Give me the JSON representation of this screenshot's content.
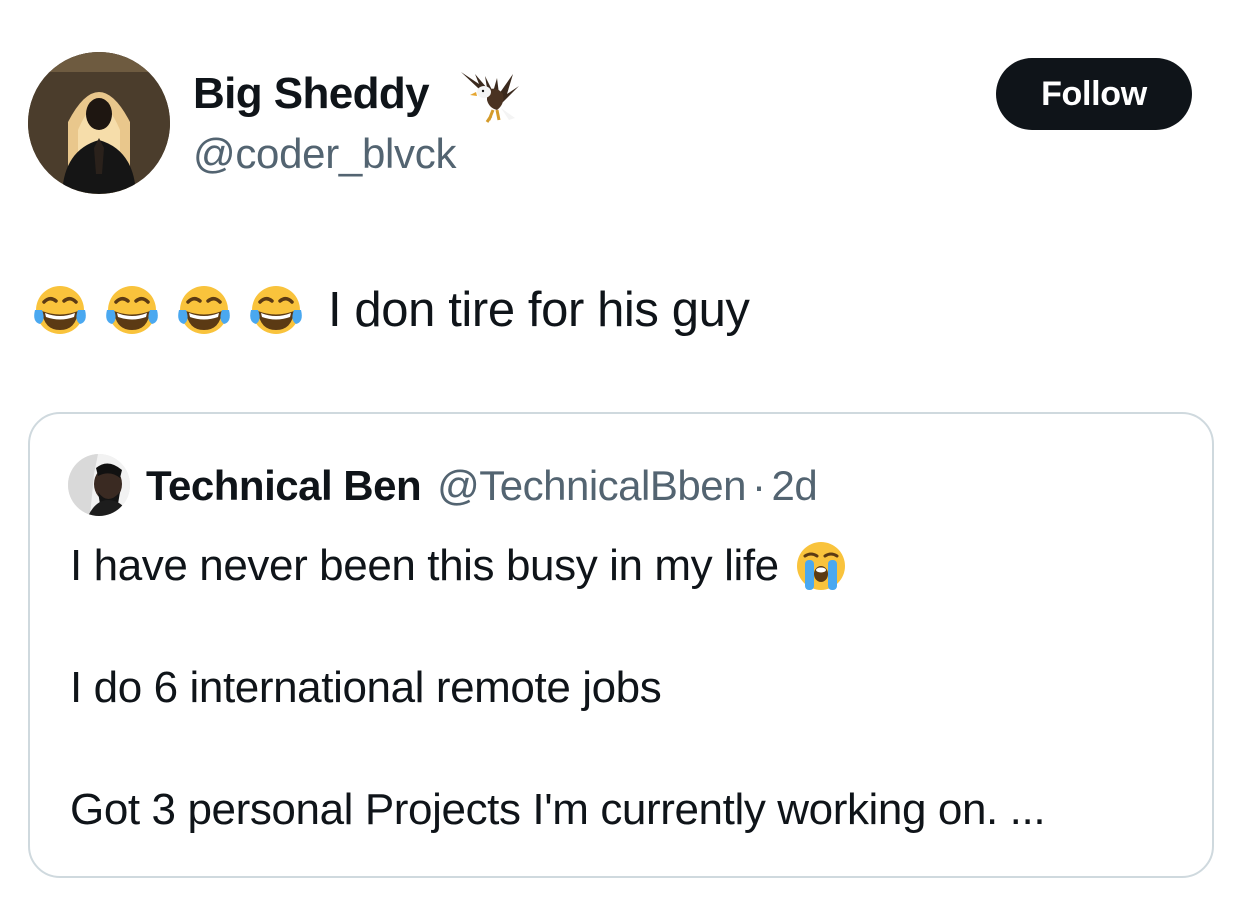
{
  "author": {
    "display_name": "Big Sheddy",
    "name_badge_icon": "eagle-icon",
    "handle": "@coder_blvck"
  },
  "follow_button": {
    "label": "Follow"
  },
  "tweet": {
    "emojis": [
      "face-with-tears-of-joy-icon",
      "face-with-tears-of-joy-icon",
      "face-with-tears-of-joy-icon",
      "face-with-tears-of-joy-icon"
    ],
    "text": "I don tire for his guy"
  },
  "quoted_tweet": {
    "display_name": "Technical Ben",
    "handle": "@TechnicalBben",
    "separator": "·",
    "time": "2d",
    "lines": [
      "I have never been this busy in my life",
      "I do 6 international remote jobs",
      "Got 3 personal Projects I'm currently working on. ..."
    ],
    "line1_emoji": "loudly-crying-face-icon"
  },
  "colors": {
    "text_primary": "#0f1419",
    "text_secondary": "#536471",
    "follow_bg": "#0f1419",
    "card_border": "#cfd9de"
  }
}
